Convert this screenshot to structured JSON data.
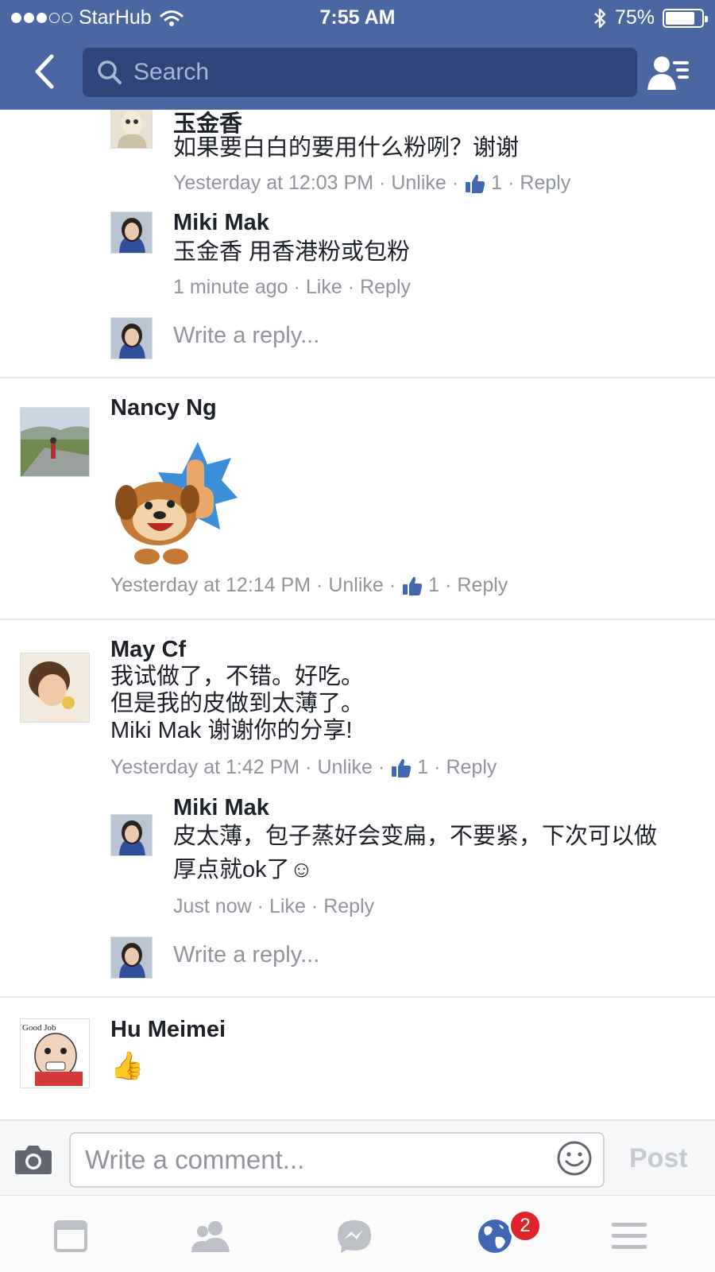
{
  "status_bar": {
    "carrier": "StarHub",
    "time": "7:55 AM",
    "battery": "75%",
    "battery_level": 0.75,
    "signal_bars": 3
  },
  "nav": {
    "search_placeholder": "Search"
  },
  "comments": [
    {
      "replies": [
        {
          "name": "玉金香",
          "text": "如果要白白的要用什么粉咧？谢谢",
          "time": "Yesterday at 12:03 PM",
          "action": "Unlike",
          "likes": "1",
          "reply": "Reply"
        },
        {
          "name": "Miki Mak",
          "text": "玉金香 用香港粉或包粉",
          "time": "1 minute ago",
          "action": "Like",
          "reply": "Reply"
        }
      ],
      "write_reply": "Write a reply..."
    },
    {
      "name": "Nancy Ng",
      "sticker": "thumbs-up-dog-sticker",
      "time": "Yesterday at 12:14 PM",
      "action": "Unlike",
      "likes": "1",
      "reply": "Reply"
    },
    {
      "name": "May Cf",
      "text_lines": [
        "我试做了，不错。好吃。",
        "但是我的皮做到太薄了。",
        "Miki Mak   谢谢你的分享!"
      ],
      "time": "Yesterday at 1:42 PM",
      "action": "Unlike",
      "likes": "1",
      "reply": "Reply",
      "replies": [
        {
          "name": "Miki Mak",
          "text_lines": [
            "皮太薄，包子蒸好会变扁，不要紧，下次可以做",
            "厚点就ok了☺"
          ],
          "time": "Just now",
          "action": "Like",
          "reply": "Reply"
        }
      ],
      "write_reply": "Write a reply..."
    },
    {
      "name": "Hu Meimei",
      "text": "👍",
      "avatar_text": "Good Job"
    }
  ],
  "composer": {
    "placeholder": "Write a comment...",
    "post_label": "Post"
  },
  "tabbar": {
    "items": [
      "news-feed-icon",
      "friends-icon",
      "messenger-icon",
      "notifications-globe-icon",
      "menu-icon"
    ],
    "notifications_badge": "2"
  },
  "colors": {
    "header": "#4b67a1",
    "search_field": "#2f4577",
    "meta_text": "#90949c",
    "like_blue": "#4267b2",
    "badge_red": "#e0242b"
  }
}
